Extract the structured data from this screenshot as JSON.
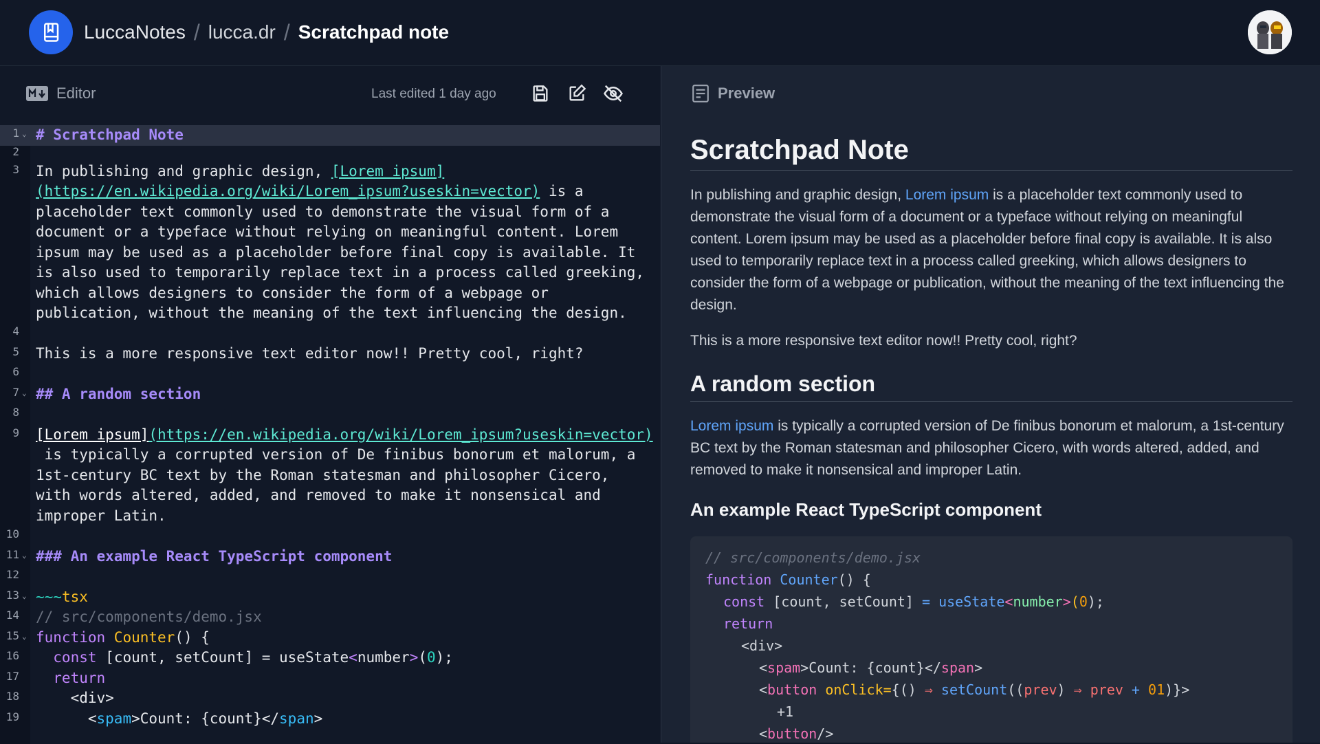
{
  "header": {
    "app_name": "LuccaNotes",
    "separator": "/",
    "username": "lucca.dr",
    "note_title": "Scratchpad note"
  },
  "editor": {
    "title": "Editor",
    "badge": "M↓",
    "last_edited": "Last edited 1 day ago",
    "tools": [
      "save-icon",
      "edit-icon",
      "hide-preview-icon"
    ]
  },
  "preview": {
    "title": "Preview",
    "h1": "Scratchpad Note",
    "p1_link": "Lorem ipsum",
    "p1_rest_a": "In publishing and graphic design, ",
    "p1_rest_b": " is a placeholder text commonly used to demonstrate the visual form of a document or a typeface without relying on meaningful content. Lorem ipsum may be used as a placeholder before final copy is available. It is also used to temporarily replace text in a process called greeking, which allows designers to consider the form of a webpage or publication, without the meaning of the text influencing the design.",
    "p2": "This is a more responsive text editor now!! Pretty cool, right?",
    "h2": "A random section",
    "p3_link": "Lorem ipsum",
    "p3_rest": " is typically a corrupted version of De finibus bonorum et malorum, a 1st-century BC text by the Roman statesman and philosopher Cicero, with words altered, added, and removed to make it nonsensical and improper Latin.",
    "h3": "An example React TypeScript component",
    "code": {
      "c1": "// src/components/demo.jsx",
      "c2_kw": "function",
      "c2_fn": "Counter",
      "c2_rest": "() {",
      "c3_kw": "const",
      "c3_mid": " [count, setCount] ",
      "c3_eq": "=",
      "c3_fn": " useState",
      "c3_lt": "<",
      "c3_type": "number",
      "c3_gt": ">",
      "c3_po": "(",
      "c3_num": "0",
      "c3_pc": ");",
      "c4_kw": "return",
      "c5": "<div>",
      "c6_a": "<",
      "c6_tag": "spam",
      "c6_b": ">Count: {count}</",
      "c6_tag2": "span",
      "c6_c": ">",
      "c7_a": "<",
      "c7_tag": "button",
      "c7_attr": " onClick=",
      "c7_b": "{() ",
      "c7_arrow": "⇒",
      "c7_fn": " setCount",
      "c7_c": "((",
      "c7_p": "prev",
      "c7_d": ") ",
      "c7_arrow2": "⇒",
      "c7_p2": " prev",
      "c7_plus": " +",
      "c7_num": " 01",
      "c7_e": ")}>",
      "c8": "+1",
      "c9_a": "<",
      "c9_tag": "button",
      "c9_b": "/>"
    }
  },
  "code_lines": {
    "l1": "# Scratchpad Note",
    "l3a": "In publishing and graphic design, ",
    "l3b": "[Lorem ipsum]",
    "l3c": "(https://en.wikipedia.org/wiki/Lorem_ipsum?useskin=vector)",
    "l3d": " is a",
    "l3e": "placeholder text commonly used to demonstrate the visual form of a",
    "l3f": "document or a typeface without relying on meaningful content. Lorem",
    "l3g": "ipsum may be used as a placeholder before final copy is available. It",
    "l3h": "is also used to temporarily replace text in a process called greeking,",
    "l3i": "which allows designers to consider the form of a webpage or",
    "l3j": "publication, without the meaning of the text influencing the design.",
    "l5": "This is a more responsive text editor now!! Pretty cool, right?",
    "l7": "## A random section",
    "l9a": "[Lorem ipsum]",
    "l9b": "(https://en.wikipedia.org/wiki/Lorem_ipsum?useskin=vector)",
    "l9c": " is typically a corrupted version of De finibus bonorum et malorum, a",
    "l9d": "1st-century BC text by the Roman statesman and philosopher Cicero,",
    "l9e": "with words altered, added, and removed to make it nonsensical and",
    "l9f": "improper Latin.",
    "l11": "### An example React TypeScript component",
    "l13a": "~~~",
    "l13b": "tsx",
    "l14": "// src/components/demo.jsx",
    "l15a": "function",
    "l15b": " Counter",
    "l15c": "() {",
    "l16a": "  const",
    "l16b": " [count, setCount] = useState",
    "l16c": "<",
    "l16d": "number",
    "l16e": ">",
    "l16f": "(",
    "l16g": "0",
    "l16h": ");",
    "l17": "  return",
    "l18": "    <div>",
    "l19a": "      <",
    "l19b": "spam",
    "l19c": ">Count: {count}</",
    "l19d": "span",
    "l19e": ">"
  },
  "line_numbers": [
    "1",
    "2",
    "3",
    "4",
    "5",
    "6",
    "7",
    "8",
    "9",
    "10",
    "11",
    "12",
    "13",
    "14",
    "15",
    "16",
    "17",
    "18",
    "19"
  ],
  "colors": {
    "accent": "#2563eb",
    "heading": "#a78bfa",
    "link": "#5eead4",
    "preview_link": "#60a5fa"
  }
}
